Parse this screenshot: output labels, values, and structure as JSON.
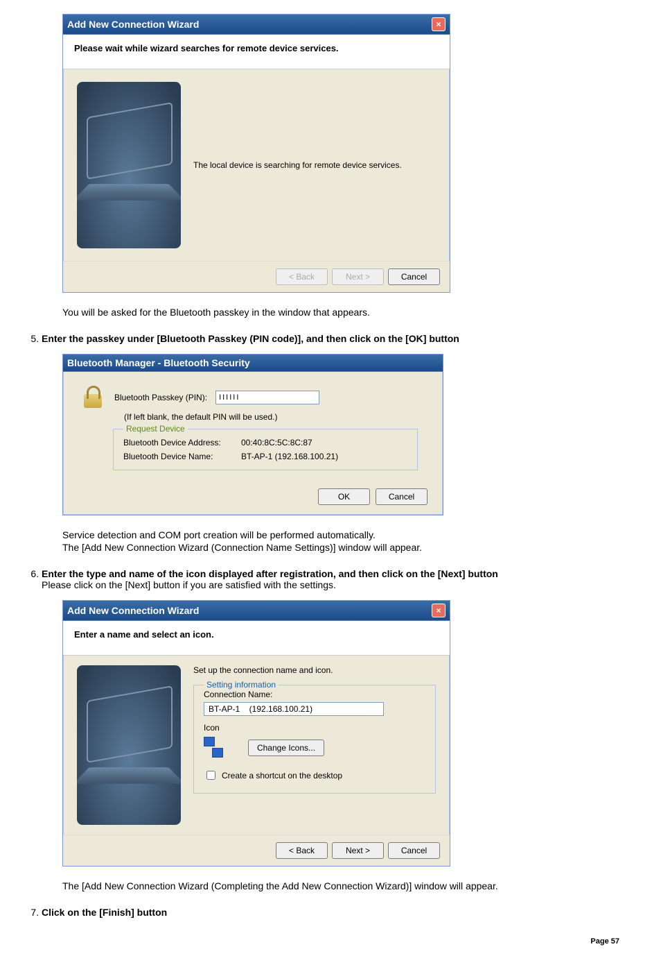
{
  "wizard1": {
    "title": "Add New Connection Wizard",
    "header": "Please wait while wizard searches for remote device services.",
    "message": "The local device is searching for remote device services.",
    "back": "< Back",
    "next": "Next >",
    "cancel": "Cancel"
  },
  "afterWizard1": "You will be asked for the Bluetooth passkey in the window that appears.",
  "step5": {
    "num": "5.",
    "text": "Enter the passkey under [Bluetooth Passkey (PIN code)], and then click on the [OK] button"
  },
  "sec": {
    "title": "Bluetooth Manager - Bluetooth Security",
    "passkeyLabel": "Bluetooth Passkey (PIN):",
    "passkeyValue": "IIIIII",
    "hint": "(If left blank, the default PIN will be used.)",
    "groupTitle": "Request Device",
    "addrLabel": "Bluetooth Device Address:",
    "addrValue": "00:40:8C:5C:8C:87",
    "nameLabel": "Bluetooth Device Name:",
    "nameValue": "BT-AP-1    (192.168.100.21)",
    "ok": "OK",
    "cancel": "Cancel"
  },
  "afterSec1": "Service detection and COM port creation will be performed automatically.",
  "afterSec2": "The [Add New Connection Wizard (Connection Name Settings)] window will appear.",
  "step6": {
    "num": "6.",
    "text": "Enter the type and name of the icon displayed after registration, and then click on the [Next] button",
    "sub": "Please click on the [Next] button if you are satisfied with the settings."
  },
  "wizard2": {
    "title": "Add New Connection Wizard",
    "header": "Enter a name and select an icon.",
    "msg": "Set up the connection name and icon.",
    "group": "Setting information",
    "connLabel": "Connection Name:",
    "connValue": "BT-AP-1    (192.168.100.21)",
    "iconLabel": "Icon",
    "changeIcons": "Change Icons...",
    "shortcut": "Create a shortcut on the desktop",
    "back": "< Back",
    "next": "Next >",
    "cancel": "Cancel"
  },
  "afterWizard2": "The [Add New Connection Wizard (Completing the Add New Connection Wizard)] window will appear.",
  "step7": {
    "num": "7.",
    "text": "Click on the [Finish] button"
  },
  "pageFooter": "Page 57"
}
